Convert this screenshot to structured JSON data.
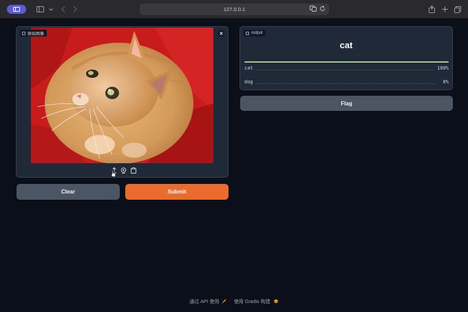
{
  "browser": {
    "url": "127.0.0.1"
  },
  "input_panel": {
    "label": "原始图像"
  },
  "buttons": {
    "clear": "Clear",
    "submit": "Submit",
    "flag": "Flag"
  },
  "output_panel": {
    "label": "output",
    "predicted_label": "cat",
    "confidences": [
      {
        "label": "cat",
        "value_text": "100%",
        "value": 1.0
      },
      {
        "label": "dog",
        "value_text": "0%",
        "value": 0.0
      }
    ]
  },
  "footer": {
    "api_link": "通过 API 使用",
    "separator": "·",
    "built_with": "使用 Gradio 构建"
  },
  "colors": {
    "primary": "#ea6b2e",
    "secondary": "#4b5563",
    "confidence_bar": "#a3c78a",
    "background": "#0b0f19"
  }
}
